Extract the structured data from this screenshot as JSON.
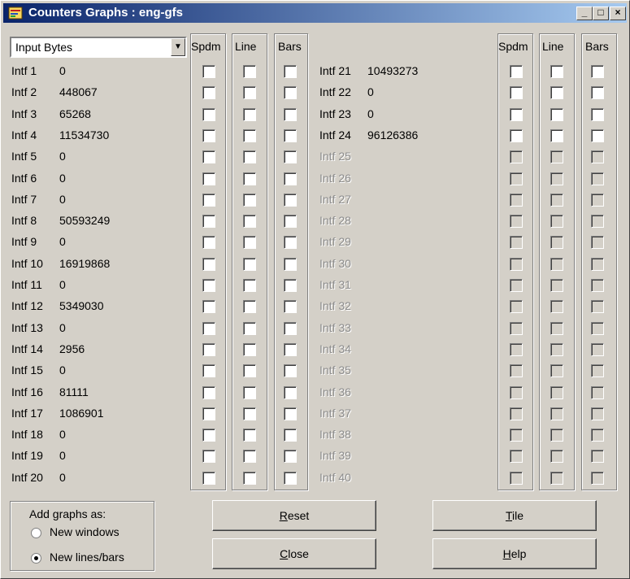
{
  "window": {
    "title": "Counters Graphs : eng-gfs",
    "minimize_glyph": "_",
    "maximize_glyph": "□",
    "close_glyph": "×"
  },
  "counter_select": {
    "value": "Input Bytes",
    "arrow_glyph": "▼"
  },
  "column_headers": {
    "spdm": "Spdm",
    "line": "Line",
    "bars": "Bars"
  },
  "left_rows": [
    {
      "name": "Intf 1",
      "value": "0"
    },
    {
      "name": "Intf 2",
      "value": "448067"
    },
    {
      "name": "Intf 3",
      "value": "65268"
    },
    {
      "name": "Intf 4",
      "value": "11534730"
    },
    {
      "name": "Intf 5",
      "value": "0"
    },
    {
      "name": "Intf 6",
      "value": "0"
    },
    {
      "name": "Intf 7",
      "value": "0"
    },
    {
      "name": "Intf 8",
      "value": "50593249"
    },
    {
      "name": "Intf 9",
      "value": "0"
    },
    {
      "name": "Intf 10",
      "value": "16919868"
    },
    {
      "name": "Intf 11",
      "value": "0"
    },
    {
      "name": "Intf 12",
      "value": "5349030"
    },
    {
      "name": "Intf 13",
      "value": "0"
    },
    {
      "name": "Intf 14",
      "value": "2956"
    },
    {
      "name": "Intf 15",
      "value": "0"
    },
    {
      "name": "Intf 16",
      "value": "81111"
    },
    {
      "name": "Intf 17",
      "value": "1086901"
    },
    {
      "name": "Intf 18",
      "value": "0"
    },
    {
      "name": "Intf 19",
      "value": "0"
    },
    {
      "name": "Intf 20",
      "value": "0"
    }
  ],
  "right_rows": [
    {
      "name": "Intf 21",
      "value": "10493273",
      "enabled": true
    },
    {
      "name": "Intf 22",
      "value": "0",
      "enabled": true
    },
    {
      "name": "Intf 23",
      "value": "0",
      "enabled": true
    },
    {
      "name": "Intf 24",
      "value": "96126386",
      "enabled": true
    },
    {
      "name": "Intf 25",
      "value": "",
      "enabled": false
    },
    {
      "name": "Intf 26",
      "value": "",
      "enabled": false
    },
    {
      "name": "Intf 27",
      "value": "",
      "enabled": false
    },
    {
      "name": "Intf 28",
      "value": "",
      "enabled": false
    },
    {
      "name": "Intf 29",
      "value": "",
      "enabled": false
    },
    {
      "name": "Intf 30",
      "value": "",
      "enabled": false
    },
    {
      "name": "Intf 31",
      "value": "",
      "enabled": false
    },
    {
      "name": "Intf 32",
      "value": "",
      "enabled": false
    },
    {
      "name": "Intf 33",
      "value": "",
      "enabled": false
    },
    {
      "name": "Intf 34",
      "value": "",
      "enabled": false
    },
    {
      "name": "Intf 35",
      "value": "",
      "enabled": false
    },
    {
      "name": "Intf 36",
      "value": "",
      "enabled": false
    },
    {
      "name": "Intf 37",
      "value": "",
      "enabled": false
    },
    {
      "name": "Intf 38",
      "value": "",
      "enabled": false
    },
    {
      "name": "Intf 39",
      "value": "",
      "enabled": false
    },
    {
      "name": "Intf 40",
      "value": "",
      "enabled": false
    }
  ],
  "add_graphs": {
    "title": "Add graphs as:",
    "options": [
      {
        "label": "New windows",
        "selected": false
      },
      {
        "label": "New lines/bars",
        "selected": true
      }
    ]
  },
  "buttons": {
    "reset": {
      "mnemonic": "R",
      "rest": "eset"
    },
    "close": {
      "mnemonic": "C",
      "rest": "lose"
    },
    "tile": {
      "mnemonic": "T",
      "rest": "ile"
    },
    "help": {
      "mnemonic": "H",
      "rest": "elp"
    }
  }
}
